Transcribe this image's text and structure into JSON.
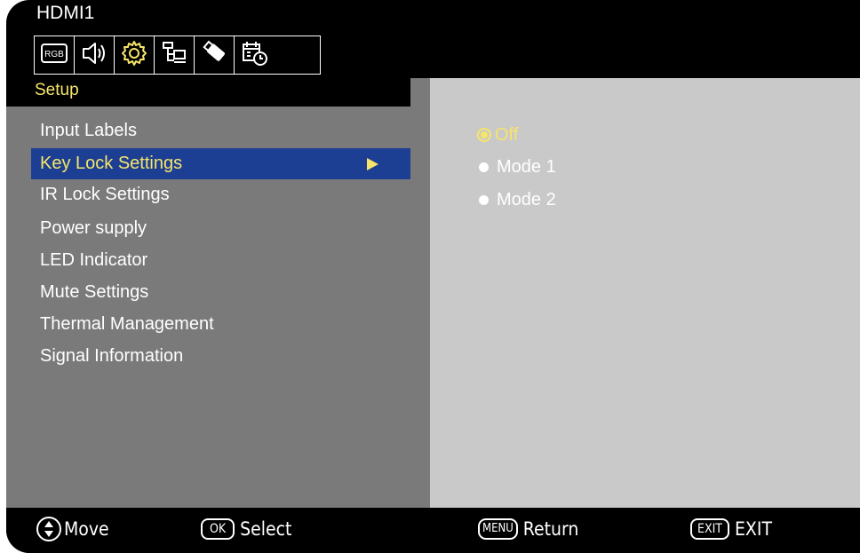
{
  "header": {
    "source": "HDMI1",
    "category": "Setup",
    "icons": [
      {
        "name": "rgb-picture-icon",
        "label": "RGB"
      },
      {
        "name": "speaker-icon"
      },
      {
        "name": "gear-icon"
      },
      {
        "name": "network-icon"
      },
      {
        "name": "usb-icon"
      },
      {
        "name": "schedule-icon"
      }
    ],
    "active_icon_color": "#f6e56a"
  },
  "menu": {
    "items": [
      {
        "label": "Input Labels"
      },
      {
        "label": "Key Lock Settings"
      },
      {
        "label": "IR Lock Settings"
      },
      {
        "label": "Power supply"
      },
      {
        "label": "LED Indicator"
      },
      {
        "label": "Mute Settings"
      },
      {
        "label": "Thermal Management"
      },
      {
        "label": "Signal Information"
      }
    ],
    "selected_index": 1
  },
  "options": {
    "items": [
      {
        "label": "Off"
      },
      {
        "label": "Mode 1"
      },
      {
        "label": "Mode 2"
      }
    ],
    "selected_index": 0
  },
  "footer": {
    "move": "Move",
    "ok_key": "OK",
    "select": "Select",
    "menu_key": "MENU",
    "return": "Return",
    "exit_key": "EXIT",
    "exit": "EXIT"
  },
  "colors": {
    "highlight": "#f6e56a",
    "selection_bg": "#1d3f93",
    "menu_panel": "#7a7a7a",
    "value_panel": "#c9c9c9"
  }
}
